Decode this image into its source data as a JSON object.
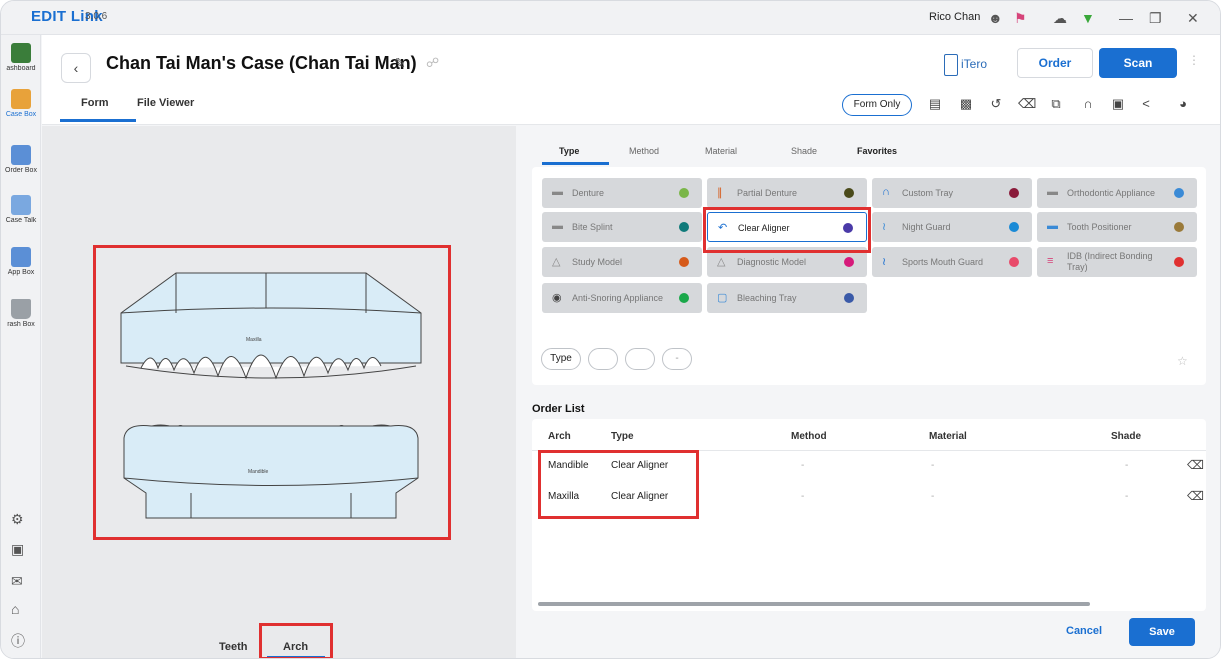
{
  "app": {
    "name": "EDIT Link",
    "version": "3.0.6",
    "user": "Rico Chan",
    "titlebar_icons": [
      "user-icon",
      "notification-icon",
      "cloud-icon",
      "wifi-icon",
      "minimize-icon",
      "restore-icon",
      "close-icon"
    ]
  },
  "sidebar": {
    "items": [
      {
        "label": "ashboard",
        "icon": "dashboard-icon",
        "color": "#3a7d3a"
      },
      {
        "label": "Case Box",
        "icon": "case-box-icon",
        "color": "#e8a23a"
      },
      {
        "label": "Order Box",
        "icon": "order-box-icon",
        "color": "#5b8fd6"
      },
      {
        "label": "Case Talk",
        "icon": "case-talk-icon",
        "color": "#5b8fd6"
      },
      {
        "label": "App Box",
        "icon": "app-box-icon",
        "color": "#5b8fd6"
      },
      {
        "label": "rash Box",
        "icon": "trash-box-icon",
        "color": "#888888"
      }
    ],
    "bottom_icons": [
      "settings-icon",
      "folder-icon",
      "megaphone-icon",
      "home-icon",
      "info-icon"
    ]
  },
  "header": {
    "title": "Chan Tai Man's Case (Chan Tai Man)",
    "itero_label": "iTero",
    "order_label": "Order",
    "scan_label": "Scan",
    "tabs": [
      "Form",
      "File Viewer"
    ],
    "form_only_label": "Form Only"
  },
  "canvas": {
    "maxilla_label": "Maxilla",
    "mandible_label": "Mandible",
    "bottom_tabs": [
      "Teeth",
      "Arch"
    ]
  },
  "right": {
    "tabs": [
      "Type",
      "Method",
      "Material",
      "Shade",
      "Favorites"
    ],
    "types": [
      {
        "label": "Denture",
        "dot": "#7ab648",
        "selected": false
      },
      {
        "label": "Partial Denture",
        "dot": "#4a4a1a",
        "selected": false
      },
      {
        "label": "Custom Tray",
        "dot": "#8a1a3a",
        "selected": false
      },
      {
        "label": "Orthodontic Appliance",
        "dot": "#3a8ad6",
        "selected": false
      },
      {
        "label": "Bite Splint",
        "dot": "#0f7a7a",
        "selected": false
      },
      {
        "label": "Clear Aligner",
        "dot": "#4a3aa8",
        "selected": true
      },
      {
        "label": "Night Guard",
        "dot": "#1a8ad6",
        "selected": false
      },
      {
        "label": "Tooth Positioner",
        "dot": "#9a7a3a",
        "selected": false
      },
      {
        "label": "Study Model",
        "dot": "#d65a1a",
        "selected": false
      },
      {
        "label": "Diagnostic Model",
        "dot": "#d61a7a",
        "selected": false
      },
      {
        "label": "Sports Mouth Guard",
        "dot": "#e84a6a",
        "selected": false
      },
      {
        "label": "IDB (Indirect Bonding Tray)",
        "dot": "#e03030",
        "selected": false
      },
      {
        "label": "Anti-Snoring Appliance",
        "dot": "#1aa84a",
        "selected": false
      },
      {
        "label": "Bleaching Tray",
        "dot": "#3a5aa8",
        "selected": false
      }
    ],
    "chips": [
      "Type",
      "",
      "",
      "-"
    ],
    "order_list_title": "Order List",
    "order_columns": [
      "Arch",
      "Type",
      "Method",
      "Material",
      "Shade"
    ],
    "orders": [
      {
        "arch": "Mandible",
        "type": "Clear Aligner",
        "method": "-",
        "material": "-",
        "shade": "-"
      },
      {
        "arch": "Maxilla",
        "type": "Clear Aligner",
        "method": "-",
        "material": "-",
        "shade": "-"
      }
    ],
    "cancel_label": "Cancel",
    "save_label": "Save"
  }
}
